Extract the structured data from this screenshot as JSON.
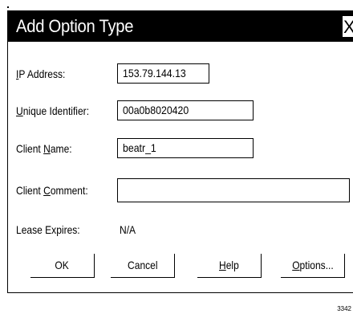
{
  "dialog": {
    "title": "Add Option Type",
    "close_label": "X"
  },
  "fields": {
    "ip_address": {
      "label_u": "I",
      "label_rest": "P Address:",
      "value": "153.79.144.13"
    },
    "unique_identifier": {
      "label_u": "U",
      "label_pre": "",
      "label_rest": "nique Identifier:",
      "value": "00a0b8020420"
    },
    "client_name": {
      "label_pre": "Client ",
      "label_u": "N",
      "label_rest": "ame:",
      "value": "beatr_1"
    },
    "client_comment": {
      "label_pre": "Client ",
      "label_u": "C",
      "label_rest": "omment:",
      "value": ""
    },
    "lease_expires": {
      "label": "Lease Expires:",
      "value": "N/A"
    }
  },
  "buttons": {
    "ok": "OK",
    "cancel": "Cancel",
    "help_u": "H",
    "help_rest": "elp",
    "options_u": "O",
    "options_rest": "ptions..."
  },
  "figure_number": "3342"
}
